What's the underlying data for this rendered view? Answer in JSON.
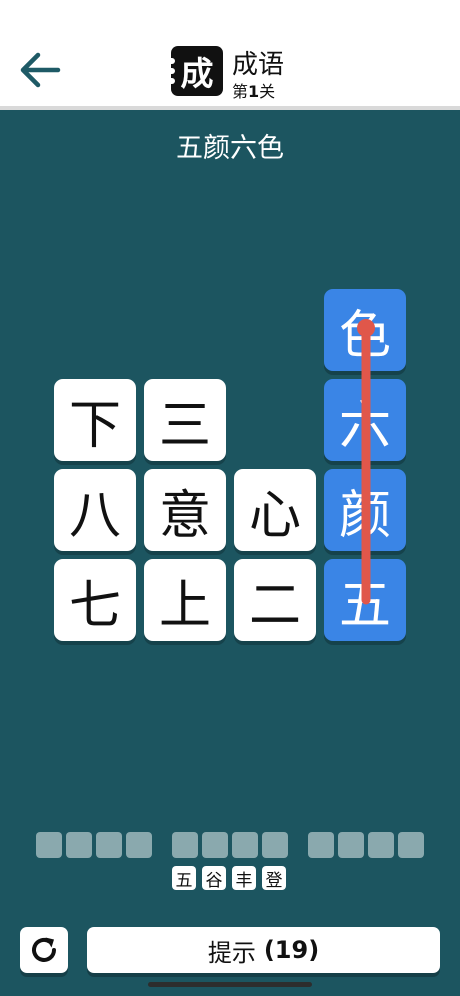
{
  "header": {
    "logo_char": "成",
    "app_title": "成语",
    "level_prefix": "第",
    "level_number": "1",
    "level_suffix": "关"
  },
  "idiom_title": "五颜六色",
  "board": {
    "tiles": [
      {
        "char": "色",
        "selected": true
      },
      {
        "char": "下",
        "selected": false
      },
      {
        "char": "三",
        "selected": false
      },
      {
        "char": "六",
        "selected": true
      },
      {
        "char": "八",
        "selected": false
      },
      {
        "char": "意",
        "selected": false
      },
      {
        "char": "心",
        "selected": false
      },
      {
        "char": "颜",
        "selected": true
      },
      {
        "char": "七",
        "selected": false
      },
      {
        "char": "上",
        "selected": false
      },
      {
        "char": "二",
        "selected": false
      },
      {
        "char": "五",
        "selected": true
      }
    ]
  },
  "answer_slots": {
    "groups": [
      4,
      4,
      4
    ]
  },
  "hint_chars": [
    "五",
    "谷",
    "丰",
    "登"
  ],
  "buttons": {
    "hint_label": "提示",
    "hint_count": "(19)"
  },
  "colors": {
    "background": "#1c5560",
    "selected_tile": "#3a85e6",
    "path_line": "#e0574a",
    "back_arrow": "#1e5a66",
    "slot": "#8aa9ae"
  },
  "icons": {
    "back": "back-arrow-icon",
    "refresh": "refresh-icon"
  }
}
